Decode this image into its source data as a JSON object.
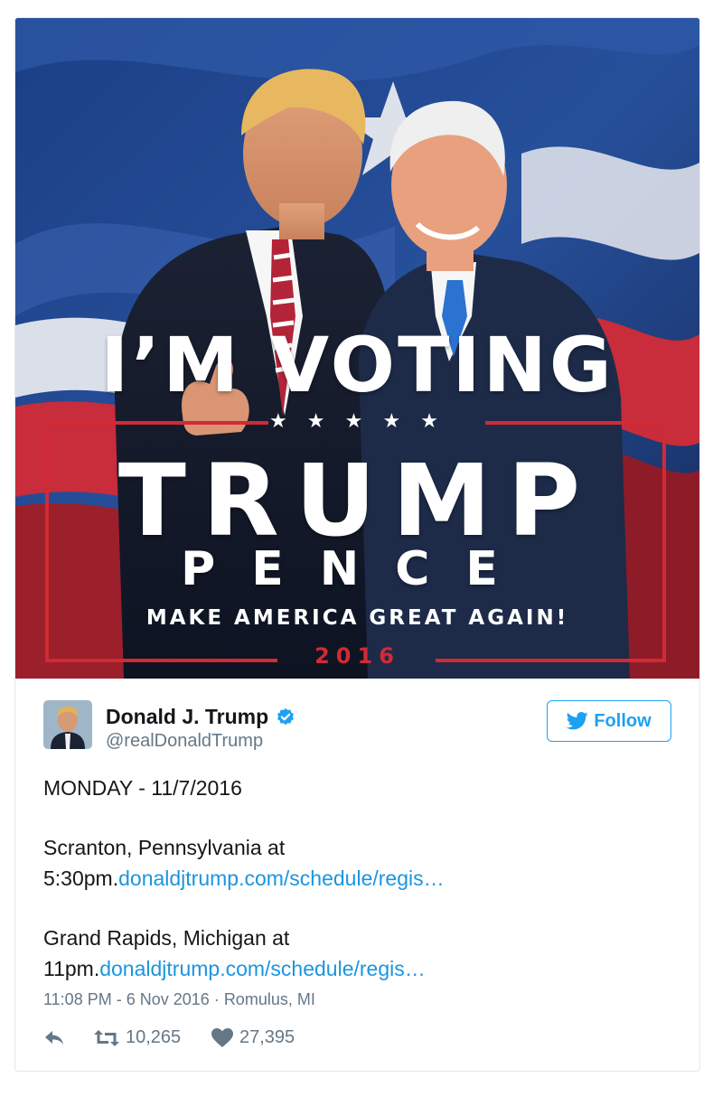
{
  "poster": {
    "headline": "I’M VOTING",
    "stars": "★ ★ ★ ★ ★",
    "candidate1": "TRUMP",
    "candidate2": "PENCE",
    "slogan": "MAKE AMERICA GREAT AGAIN!",
    "year": "2016"
  },
  "author": {
    "name": "Donald J. Trump",
    "handle": "@realDonaldTrump",
    "verified": true
  },
  "follow_label": "Follow",
  "tweet": {
    "line_date": "MONDAY - 11/7/2016",
    "event1_text": "Scranton, Pennsylvania at",
    "event1_time": "5:30pm.",
    "event1_link": "donaldjtrump.com/schedule/regis…",
    "event2_text": "Grand Rapids, Michigan at",
    "event2_time": "11pm.",
    "event2_link": "donaldjtrump.com/schedule/regis…"
  },
  "meta": {
    "timestamp": "11:08 PM - 6 Nov 2016",
    "separator": "·",
    "location": "Romulus, MI"
  },
  "stats": {
    "retweets": "10,265",
    "likes": "27,395"
  },
  "colors": {
    "link": "#1b95e0",
    "follow": "#1da1f2",
    "muted": "#657786",
    "poster_red": "#d22a35",
    "poster_navy": "#1a2c5e"
  },
  "icons": [
    "twitter-bird-icon",
    "verified-badge-icon",
    "reply-icon",
    "retweet-icon",
    "heart-icon"
  ]
}
